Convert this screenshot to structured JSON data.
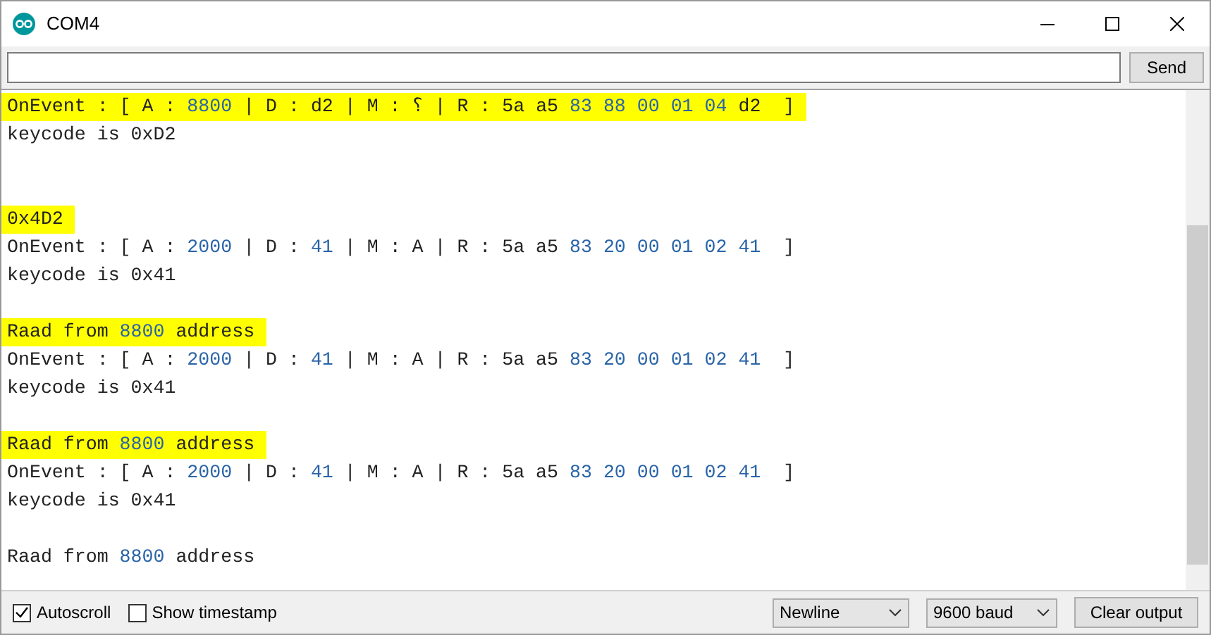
{
  "window": {
    "title": "COM4"
  },
  "send_button": "Send",
  "lines": [
    {
      "kind": "text",
      "highlighted": true,
      "parts": [
        {
          "kind": "plain",
          "text": "OnEvent : [ A : "
        },
        {
          "kind": "number",
          "text": "8800"
        },
        {
          "kind": "plain",
          "text": " | D : d2 | M : ؟ | R : 5a a5 "
        },
        {
          "kind": "number",
          "text": "83 88 00 01 04"
        },
        {
          "kind": "plain",
          "text": " d2  ]"
        }
      ]
    },
    {
      "kind": "text",
      "highlighted": false,
      "parts": [
        {
          "kind": "plain",
          "text": "keycode is 0xD2"
        }
      ]
    },
    {
      "kind": "blank"
    },
    {
      "kind": "blank"
    },
    {
      "kind": "text",
      "highlighted": true,
      "parts": [
        {
          "kind": "plain",
          "text": "0x4D2"
        }
      ]
    },
    {
      "kind": "text",
      "highlighted": false,
      "parts": [
        {
          "kind": "plain",
          "text": "OnEvent : [ A : "
        },
        {
          "kind": "number",
          "text": "2000"
        },
        {
          "kind": "plain",
          "text": " | D : "
        },
        {
          "kind": "number",
          "text": "41"
        },
        {
          "kind": "plain",
          "text": " | M : A | R : 5a a5 "
        },
        {
          "kind": "number",
          "text": "83 20 00 01 02 41"
        },
        {
          "kind": "plain",
          "text": "  ]"
        }
      ]
    },
    {
      "kind": "text",
      "highlighted": false,
      "parts": [
        {
          "kind": "plain",
          "text": "keycode is 0x41"
        }
      ]
    },
    {
      "kind": "blank"
    },
    {
      "kind": "text",
      "highlighted": true,
      "parts": [
        {
          "kind": "plain",
          "text": "Raad from "
        },
        {
          "kind": "number",
          "text": "8800"
        },
        {
          "kind": "plain",
          "text": " address"
        }
      ]
    },
    {
      "kind": "text",
      "highlighted": false,
      "parts": [
        {
          "kind": "plain",
          "text": "OnEvent : [ A : "
        },
        {
          "kind": "number",
          "text": "2000"
        },
        {
          "kind": "plain",
          "text": " | D : "
        },
        {
          "kind": "number",
          "text": "41"
        },
        {
          "kind": "plain",
          "text": " | M : A | R : 5a a5 "
        },
        {
          "kind": "number",
          "text": "83 20 00 01 02 41"
        },
        {
          "kind": "plain",
          "text": "  ]"
        }
      ]
    },
    {
      "kind": "text",
      "highlighted": false,
      "parts": [
        {
          "kind": "plain",
          "text": "keycode is 0x41"
        }
      ]
    },
    {
      "kind": "blank"
    },
    {
      "kind": "text",
      "highlighted": true,
      "parts": [
        {
          "kind": "plain",
          "text": "Raad from "
        },
        {
          "kind": "number",
          "text": "8800"
        },
        {
          "kind": "plain",
          "text": " address"
        }
      ]
    },
    {
      "kind": "text",
      "highlighted": false,
      "parts": [
        {
          "kind": "plain",
          "text": "OnEvent : [ A : "
        },
        {
          "kind": "number",
          "text": "2000"
        },
        {
          "kind": "plain",
          "text": " | D : "
        },
        {
          "kind": "number",
          "text": "41"
        },
        {
          "kind": "plain",
          "text": " | M : A | R : 5a a5 "
        },
        {
          "kind": "number",
          "text": "83 20 00 01 02 41"
        },
        {
          "kind": "plain",
          "text": "  ]"
        }
      ]
    },
    {
      "kind": "text",
      "highlighted": false,
      "parts": [
        {
          "kind": "plain",
          "text": "keycode is 0x41"
        }
      ]
    },
    {
      "kind": "blank"
    },
    {
      "kind": "text",
      "highlighted": false,
      "parts": [
        {
          "kind": "plain",
          "text": "Raad from "
        },
        {
          "kind": "number",
          "text": "8800"
        },
        {
          "kind": "plain",
          "text": " address"
        }
      ]
    }
  ],
  "options": [
    {
      "label": "Autoscroll",
      "checked": true
    },
    {
      "label": "Show timestamp",
      "checked": false
    }
  ],
  "line_ending": "Newline",
  "baud": "9600 baud",
  "clear_button": "Clear output"
}
